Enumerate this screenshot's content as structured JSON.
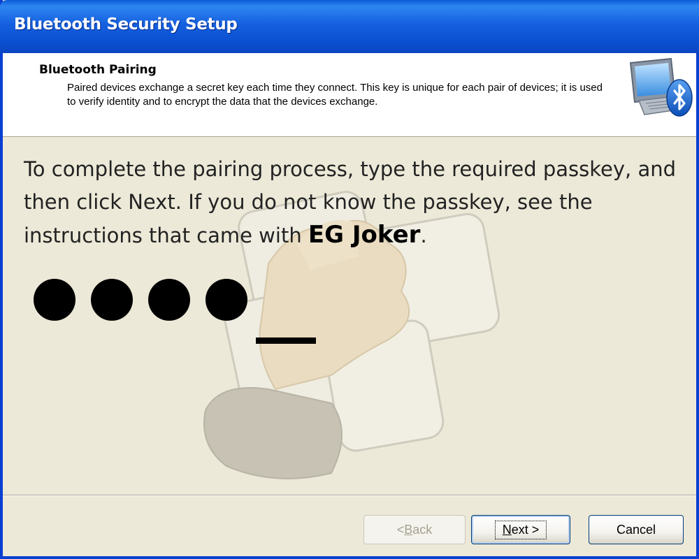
{
  "window": {
    "title": "Bluetooth Security Setup"
  },
  "header": {
    "title": "Bluetooth Pairing",
    "description": "Paired devices exchange a secret key each time they connect. This key is unique for each pair of devices; it is used to verify identity and to encrypt the data that the devices exchange.",
    "icon": "bluetooth-computer-icon"
  },
  "content": {
    "instructions_before": "To complete the pairing process, type the required passkey, and then click Next. If you do not know the passkey, see the instructions that came with ",
    "device_name": "EG Joker",
    "instructions_after": ".",
    "passkey_length": 4,
    "illustration": "hand-on-keypad-illustration"
  },
  "buttons": {
    "back_prefix": "< ",
    "back_accel": "B",
    "back_rest": "ack",
    "next_accel": "N",
    "next_rest": "ext >",
    "cancel": "Cancel"
  },
  "colors": {
    "titlebar": "#0a5bd6",
    "dialog_bg": "#ece9d8",
    "accent": "#0a3fd1"
  }
}
